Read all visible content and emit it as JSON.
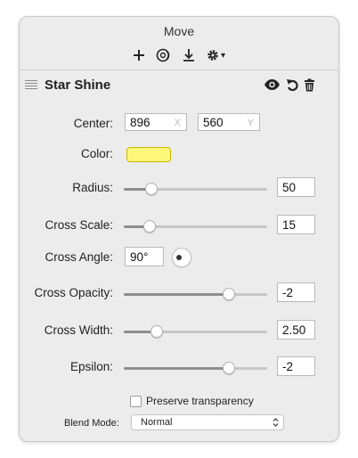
{
  "window": {
    "title": "Move"
  },
  "toolbar": {
    "buttons": [
      "plus-icon",
      "layers-icon",
      "download-icon",
      "gear-icon"
    ],
    "gear_menu_arrow": "▾"
  },
  "effect": {
    "name": "Star Shine",
    "icons": [
      "eye-icon",
      "reset-icon",
      "trash-icon"
    ]
  },
  "params": {
    "center": {
      "label": "Center:",
      "x": "896",
      "x_placeholder": "X",
      "y": "560",
      "y_placeholder": "Y"
    },
    "color": {
      "label": "Color:",
      "value": "#fdf77a"
    },
    "radius": {
      "label": "Radius:",
      "value": "50",
      "level": 0.19
    },
    "cross_scale": {
      "label": "Cross Scale:",
      "value": "15",
      "level": 0.18
    },
    "cross_angle": {
      "label": "Cross Angle:",
      "value": "90°"
    },
    "cross_opacity": {
      "label": "Cross Opacity:",
      "value": "-2",
      "level": 0.73
    },
    "cross_width": {
      "label": "Cross Width:",
      "value": "2.50",
      "level": 0.23
    },
    "epsilon": {
      "label": "Epsilon:",
      "value": "-2",
      "level": 0.73
    }
  },
  "options": {
    "preserve_transparency": {
      "label": "Preserve transparency",
      "checked": false
    },
    "blend_mode": {
      "label": "Blend Mode:",
      "value": "Normal"
    }
  }
}
